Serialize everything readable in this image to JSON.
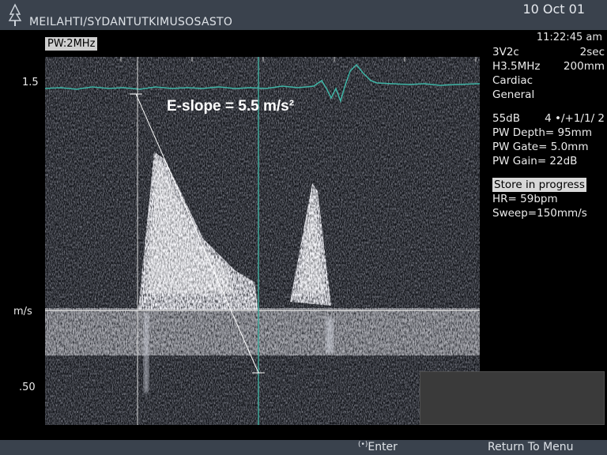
{
  "header": {
    "site": "MEILAHTI/SYDANTUTKIMUSOSASTO",
    "date": "10 Oct 01"
  },
  "mode": "PW:2MHz",
  "side_panel": {
    "time": "11:22:45 am",
    "probe": "3V2c",
    "sweep_time": "2sec",
    "frequency": "H3.5MHz",
    "depth": "200mm",
    "app": "Cardiac",
    "preset": "General",
    "gain_db": "55dB",
    "settings": "4 •/+1/1/ 2",
    "pw_depth": "PW Depth=  95mm",
    "pw_gate": "PW Gate=  5.0mm",
    "pw_gain": "PW Gain=  22dB",
    "store_status": "Store in progress",
    "hr": "HR=  59bpm",
    "sweep": "Sweep=150mm/s"
  },
  "axis": {
    "top": "1.5",
    "unit": "m/s",
    "bottom": ".50"
  },
  "annotation": "E-slope = 5.5 m/s²",
  "footer": {
    "enter_icon": "(•)",
    "enter": "Enter",
    "return_menu": "Return To Menu"
  },
  "colors": {
    "bar": "#3a424d",
    "ecg": "#3fb5a6",
    "cursor": "#3fa89a"
  }
}
